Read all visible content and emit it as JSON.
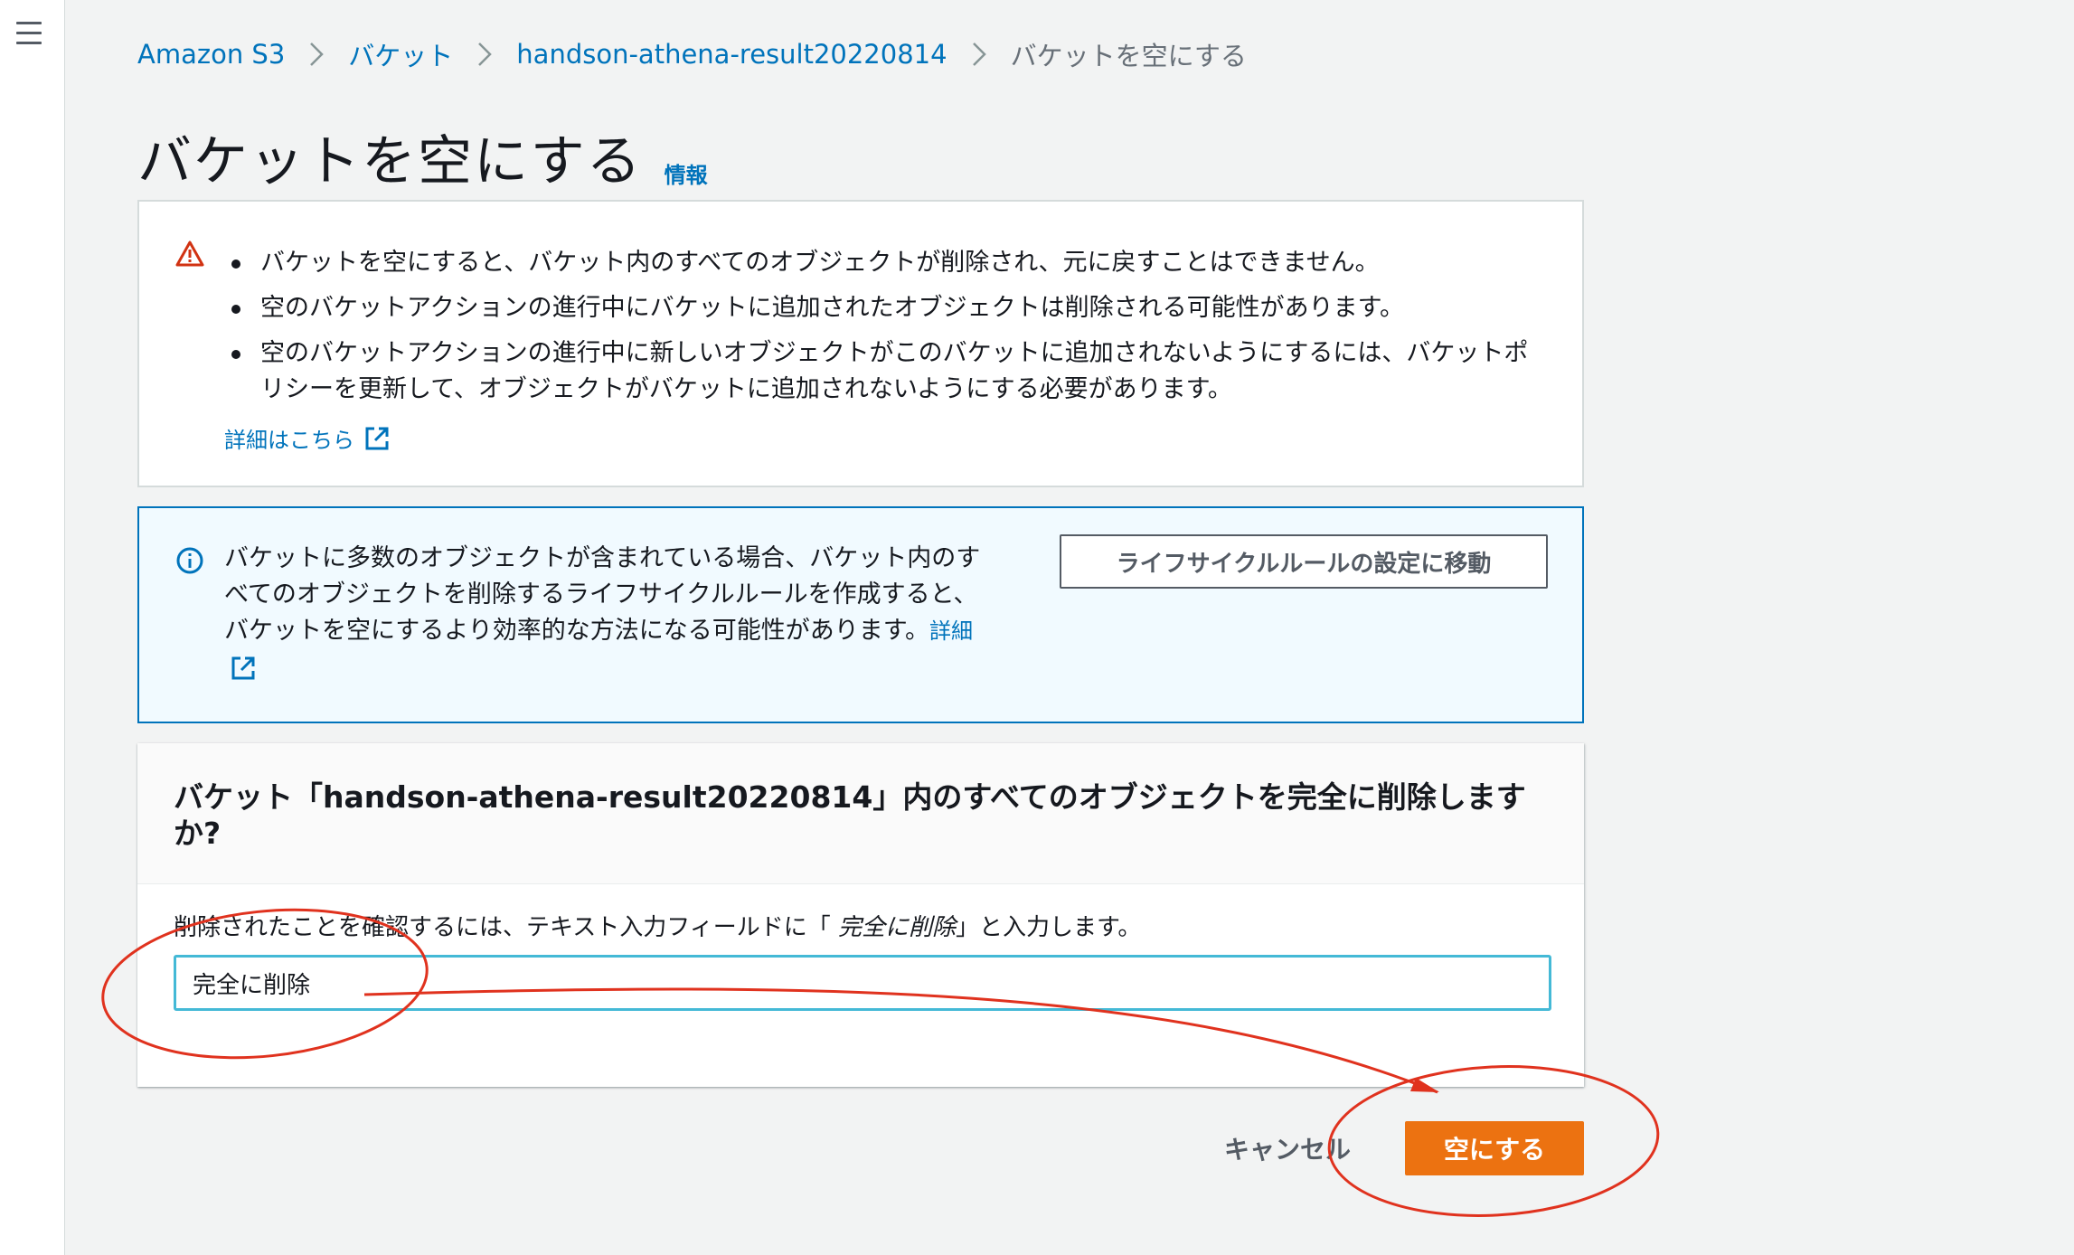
{
  "nav": {
    "menu_icon": "hamburger-menu-icon"
  },
  "breadcrumb": {
    "items": [
      "Amazon S3",
      "バケット",
      "handson-athena-result20220814"
    ],
    "current": "バケットを空にする",
    "separator_icon": "chevron-right-icon"
  },
  "page": {
    "title": "バケットを空にする",
    "info_link": "情報"
  },
  "warning": {
    "icon": "warning-triangle-icon",
    "items": [
      "バケットを空にすると、バケット内のすべてのオブジェクトが削除され、元に戻すことはできません。",
      "空のバケットアクションの進行中にバケットに追加されたオブジェクトは削除される可能性があります。",
      "空のバケットアクションの進行中に新しいオブジェクトがこのバケットに追加されないようにするには、バケットポリシーを更新して、オブジェクトがバケットに追加されないようにする必要があります。"
    ],
    "learn_more": "詳細はこちら"
  },
  "info": {
    "icon": "info-circle-icon",
    "text": "バケットに多数のオブジェクトが含まれている場合、バケット内のすべてのオブジェクトを削除するライフサイクルルールを作成すると、バケットを空にするより効率的な方法になる可能性があります。",
    "link": "詳細",
    "button": "ライフサイクルルールの設定に移動"
  },
  "confirm": {
    "title": "バケット「handson-athena-result20220814」内のすべてのオブジェクトを完全に削除しますか?",
    "label_prefix": "削除されたことを確認するには、テキスト入力フィールドに「 ",
    "label_keyword": "完全に削除",
    "label_suffix": "」と入力します。",
    "input_value": "完全に削除"
  },
  "actions": {
    "cancel": "キャンセル",
    "submit": "空にする"
  },
  "colors": {
    "link": "#0073bb",
    "primary": "#ec7211",
    "warning": "#d13212",
    "annotation": "#e0321e"
  }
}
